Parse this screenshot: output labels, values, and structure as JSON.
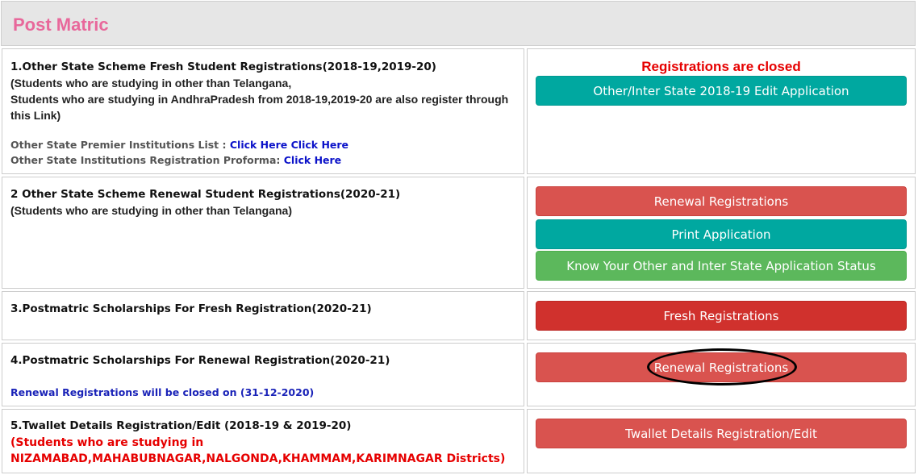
{
  "header": {
    "title": "Post Matric"
  },
  "sections": [
    {
      "title": "1.Other State Scheme Fresh Student Registrations(2018-19,2019-20)",
      "sub_line1": "(Students who are studying in other than Telangana,",
      "sub_line2": " Students who are studying in AndhraPradesh from 2018-19,2019-20 are also register through this Link)",
      "premier_label": "Other State Premier Institutions List : ",
      "premier_link1": "Click Here",
      "premier_link2": "Click Here",
      "proforma_label": "Other State Institutions Registration Proforma: ",
      "proforma_link": "Click Here",
      "closed_text": "Registrations are closed",
      "button": "Other/Inter State 2018-19 Edit Application"
    },
    {
      "title": "2 Other State Scheme Renewal Student Registrations(2020-21)",
      "sub": "(Students who are studying in other than Telangana)",
      "buttons": [
        "Renewal Registrations",
        "Print Application",
        "Know Your Other and Inter State Application Status"
      ]
    },
    {
      "title": "3.Postmatric Scholarships For Fresh Registration(2020-21)",
      "button": "Fresh Registrations"
    },
    {
      "title": "4.Postmatric Scholarships For Renewal Registration(2020-21)",
      "note": "Renewal Registrations will be closed on (31-12-2020)",
      "button": "Renewal Registrations"
    },
    {
      "title": "5.Twallet Details Registration/Edit (2018-19 & 2019-20)",
      "note_line1": "(Students who are studying in",
      "note_line2": "NIZAMABAD,MAHABUBNAGAR,NALGONDA,KHAMMAM,KARIMNAGAR Districts)",
      "button": "Twallet Details Registration/Edit"
    }
  ]
}
